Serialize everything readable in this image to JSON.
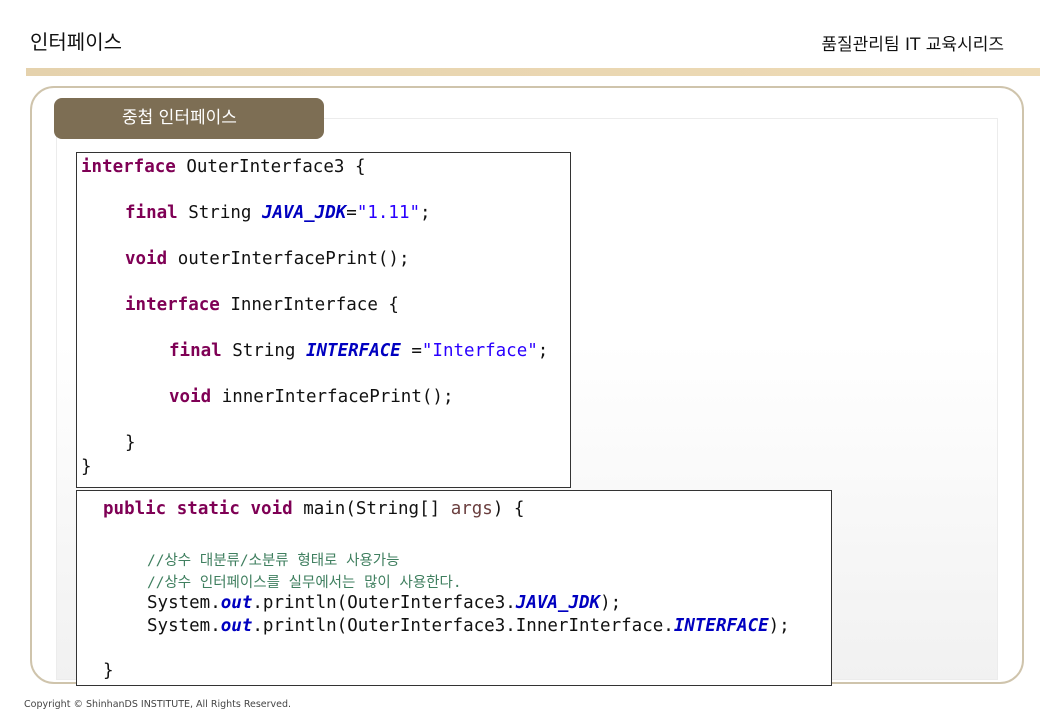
{
  "header": {
    "title": "인터페이스",
    "series": "품질관리팀 IT 교육시리즈"
  },
  "section": {
    "tab_label": "중첩 인터페이스"
  },
  "code_block_1": {
    "l1_kw": "interface",
    "l1_rest": " OuterInterface3 {",
    "l2_kw": "final",
    "l2_type": " String ",
    "l2_const": "JAVA_JDK",
    "l2_eq": "=",
    "l2_str": "\"1.11\"",
    "l2_end": ";",
    "l3_kw": "void",
    "l3_rest": " outerInterfacePrint();",
    "l4_kw": "interface",
    "l4_rest": " InnerInterface {",
    "l5_kw": "final",
    "l5_type": " String ",
    "l5_const": "INTERFACE",
    "l5_eq": " =",
    "l5_str": "\"Interface\"",
    "l5_end": ";",
    "l6_kw": "void",
    "l6_rest": " innerInterfacePrint();",
    "l7": "}",
    "l8": "}"
  },
  "code_block_2": {
    "l1_kw": "public static void",
    "l1_mid": " main(String[] ",
    "l1_par": "args",
    "l1_end": ") {",
    "c1": "//상수 대분류/소분류 형태로 사용가능",
    "c2": "//상수 인터페이스를 실무에서는 많이 사용한다.",
    "p1_a": "System.",
    "p1_out": "out",
    "p1_b": ".println(OuterInterface3.",
    "p1_const": "JAVA_JDK",
    "p1_end": ");",
    "p2_a": "System.",
    "p2_out": "out",
    "p2_b": ".println(OuterInterface3.InnerInterface.",
    "p2_const": "INTERFACE",
    "p2_end": ");",
    "close": "}"
  },
  "footer": {
    "copyright": "Copyright © ShinhanDS INSTITUTE, All Rights Reserved."
  }
}
